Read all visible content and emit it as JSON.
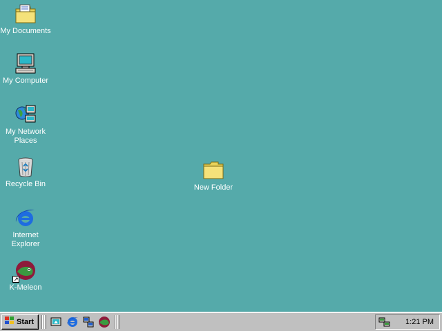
{
  "desktop": {
    "background_color": "#55AAAA",
    "icons": [
      {
        "label": "My Documents",
        "icon": "folder-documents-icon"
      },
      {
        "label": "My Computer",
        "icon": "computer-icon"
      },
      {
        "label": "My Network Places",
        "icon": "network-places-icon"
      },
      {
        "label": "Recycle Bin",
        "icon": "recycle-bin-icon"
      },
      {
        "label": "Internet Explorer",
        "icon": "internet-explorer-icon"
      },
      {
        "label": "K-Meleon",
        "icon": "k-meleon-icon",
        "shortcut": true
      },
      {
        "label": "New Folder",
        "icon": "folder-icon"
      }
    ]
  },
  "taskbar": {
    "start_label": "Start",
    "quick_launch": [
      {
        "icon": "show-desktop-icon"
      },
      {
        "icon": "internet-explorer-icon"
      },
      {
        "icon": "network-icon"
      },
      {
        "icon": "k-meleon-icon"
      }
    ],
    "tray": {
      "icon": "network-connection-icon",
      "clock": "1:21 PM"
    }
  }
}
